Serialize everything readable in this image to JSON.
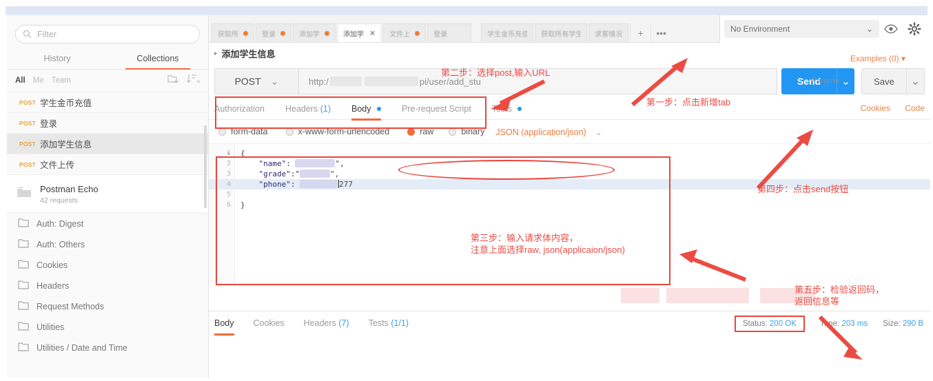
{
  "sidebar": {
    "filter_placeholder": "Filter",
    "filter_value": "",
    "tabs": [
      {
        "label": "History",
        "active": false
      },
      {
        "label": "Collections",
        "active": true
      }
    ],
    "scope_filters": [
      {
        "label": "All",
        "active": true
      },
      {
        "label": "Me",
        "active": false
      },
      {
        "label": "Team",
        "active": false
      }
    ],
    "new_folder_icon": "new-folder-icon",
    "sort_icon": "sort-descending-icon",
    "requests": [
      {
        "method": "POST",
        "name": "学生金币充值",
        "selected": false
      },
      {
        "method": "POST",
        "name": "登录",
        "selected": false
      },
      {
        "method": "POST",
        "name": "添加学生信息",
        "selected": true
      },
      {
        "method": "POST",
        "name": "文件上传",
        "selected": false
      }
    ],
    "collection": {
      "title": "Postman Echo",
      "subtitle": "42 requests",
      "icon": "collection-folder-icon"
    },
    "folders": [
      {
        "label": "Auth: Digest"
      },
      {
        "label": "Auth: Others"
      },
      {
        "label": "Cookies"
      },
      {
        "label": "Headers"
      },
      {
        "label": "Request Methods"
      },
      {
        "label": "Utilities"
      },
      {
        "label": "Utilities / Date and Time"
      }
    ]
  },
  "tabbar": {
    "tabs": [
      {
        "label": "获取所",
        "dirty": true,
        "active": false,
        "closable": false
      },
      {
        "label": "登录",
        "dirty": true,
        "active": false,
        "closable": false
      },
      {
        "label": "添加学",
        "dirty": true,
        "active": false,
        "closable": false
      },
      {
        "label": "添加学",
        "dirty": false,
        "active": true,
        "closable": true
      },
      {
        "label": "文件上",
        "dirty": true,
        "active": false,
        "closable": false
      },
      {
        "label": "登录",
        "dirty": false,
        "active": false,
        "closable": false
      },
      {
        "label": "学生金币充值",
        "dirty": false,
        "active": false,
        "closable": false
      },
      {
        "label": "获取所有学生",
        "dirty": false,
        "active": false,
        "closable": false
      },
      {
        "label": "求客情况",
        "dirty": false,
        "active": false,
        "closable": false
      }
    ],
    "new_tab_label": "+",
    "more_label": "•••"
  },
  "environment": {
    "selected": "No Environment",
    "caret": "⌄",
    "eye_icon": "eye-icon",
    "gear_icon": "gear-icon"
  },
  "request": {
    "breadcrumb": "添加学生信息",
    "breadcrumb_arrow": "▸",
    "method": "POST",
    "method_caret": "⌄",
    "url_prefix": "http:/",
    "url_suffix": "pi/user/add_stu",
    "params_label": "Params",
    "send_label": "Send",
    "send_caret": "⌄",
    "save_label": "Save",
    "save_caret": "⌄",
    "examples_label": "Examples (0)",
    "examples_caret": "▾",
    "tabs": [
      {
        "label": "Authorization",
        "count": "",
        "dot": false,
        "active": false
      },
      {
        "label": "Headers",
        "count": "(1)",
        "dot": false,
        "active": false
      },
      {
        "label": "Body",
        "count": "",
        "dot": true,
        "active": true
      },
      {
        "label": "Pre-request Script",
        "count": "",
        "dot": false,
        "active": false
      },
      {
        "label": "Tests",
        "count": "",
        "dot": true,
        "active": false
      }
    ],
    "cookies_link": "Cookies",
    "code_link": "Code",
    "body_types": [
      {
        "label": "form-data",
        "selected": false
      },
      {
        "label": "x-www-form-urlencoded",
        "selected": false
      },
      {
        "label": "raw",
        "selected": true
      },
      {
        "label": "binary",
        "selected": false
      }
    ],
    "raw_format": "JSON (application/json)",
    "raw_format_caret": "⌄",
    "body_lines": [
      {
        "n": "1",
        "text": "{",
        "fold": true,
        "highlight": false
      },
      {
        "n": "2",
        "text": "    \"name\": ",
        "fold": false,
        "highlight": false,
        "redacted": true,
        "tail": "\","
      },
      {
        "n": "3",
        "text": "    \"grade\":\"",
        "fold": false,
        "highlight": false,
        "redacted": true,
        "tail": "\","
      },
      {
        "n": "4",
        "text": "    \"phone\": ",
        "fold": false,
        "highlight": true,
        "redacted": true,
        "tail": "277"
      },
      {
        "n": "5",
        "text": "",
        "fold": false,
        "highlight": false
      },
      {
        "n": "6",
        "text": "}",
        "fold": false,
        "highlight": false
      }
    ]
  },
  "response": {
    "tabs": [
      {
        "label": "Body",
        "count": "",
        "active": true
      },
      {
        "label": "Cookies",
        "count": "",
        "active": false
      },
      {
        "label": "Headers",
        "count": "(7)",
        "active": false
      },
      {
        "label": "Tests",
        "count": "(1/1)",
        "active": false
      }
    ],
    "status_label": "Status:",
    "status_value": "200 OK",
    "time_label": "Time:",
    "time_value": "203 ms",
    "size_label": "Size:",
    "size_value": "290 B"
  },
  "annotations": [
    {
      "id": "step1",
      "text": "第一步：点击新增tab"
    },
    {
      "id": "step2",
      "text": "第二步：选择post,输入URL"
    },
    {
      "id": "step3",
      "text": "第三步：输入请求体内容，\n注意上面选择raw, json(applicaion/json)"
    },
    {
      "id": "step4",
      "text": "第四步：点击send按钮"
    },
    {
      "id": "step5",
      "text": "第五步：检验返回码，\n返回信息等"
    }
  ],
  "colors": {
    "accent_orange": "#f26b3a",
    "send_blue": "#2196f3",
    "annotation_red": "#ec4b43",
    "method_post": "#e8a33d",
    "link_blue": "#3aa0e8"
  }
}
